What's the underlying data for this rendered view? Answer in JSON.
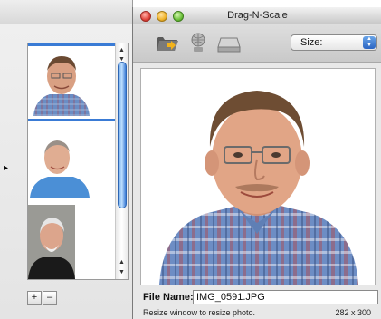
{
  "window": {
    "title": "Drag-N-Scale"
  },
  "toolbar": {
    "icons": [
      "folder-icon",
      "web-icon",
      "disk-icon"
    ],
    "size_select": "Size:"
  },
  "sidebar": {
    "thumbnails": [
      "person-1",
      "person-2",
      "person-3"
    ],
    "selected_index": 0,
    "add_label": "+",
    "remove_label": "–"
  },
  "file": {
    "label": "File Name:",
    "name": "IMG_0591.JPG"
  },
  "status": {
    "message": "Resize window to resize photo.",
    "dimensions": "282 x 300"
  }
}
